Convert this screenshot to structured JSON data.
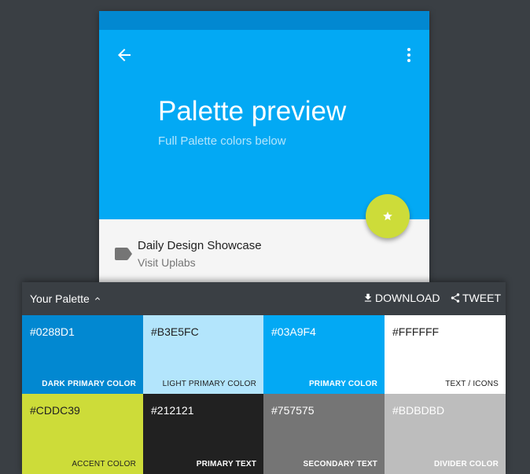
{
  "preview": {
    "title": "Palette preview",
    "subtitle": "Full Palette colors below",
    "list_item": {
      "title": "Daily Design Showcase",
      "subtitle": "Visit Uplabs"
    }
  },
  "panel": {
    "title": "Your Palette",
    "download_label": "DOWNLOAD",
    "tweet_label": "TWEET"
  },
  "swatches": [
    {
      "hex": "#0288D1",
      "role": "DARK PRIMARY COLOR",
      "color": "#0288D1"
    },
    {
      "hex": "#B3E5FC",
      "role": "LIGHT PRIMARY COLOR",
      "color": "#B3E5FC"
    },
    {
      "hex": "#03A9F4",
      "role": "PRIMARY COLOR",
      "color": "#03A9F4"
    },
    {
      "hex": "#FFFFFF",
      "role": "TEXT / ICONS",
      "color": "#FFFFFF"
    },
    {
      "hex": "#CDDC39",
      "role": "ACCENT COLOR",
      "color": "#CDDC39"
    },
    {
      "hex": "#212121",
      "role": "PRIMARY TEXT",
      "color": "#212121"
    },
    {
      "hex": "#757575",
      "role": "SECONDARY TEXT",
      "color": "#757575"
    },
    {
      "hex": "#BDBDBD",
      "role": "DIVIDER COLOR",
      "color": "#BDBDBD"
    }
  ],
  "colors": {
    "background": "#3a3f44",
    "dark_primary": "#0288D1",
    "primary": "#03A9F4",
    "light_primary": "#B3E5FC",
    "accent": "#CDDC39"
  },
  "icons": {
    "back": "arrow-back-icon",
    "more": "more-vert-icon",
    "fab": "star-icon",
    "label": "label-icon",
    "expand": "chevron-up-icon",
    "download": "download-icon",
    "tweet": "share-icon"
  }
}
